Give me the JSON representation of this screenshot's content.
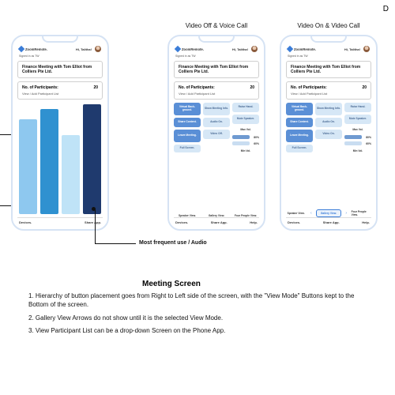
{
  "top_right_letter": "D",
  "columns": {
    "video_off": "Video Off & Voice Call",
    "video_on": "Video On & Video Call"
  },
  "phone_common": {
    "brand": "ZoomRemote.",
    "greeting": "Hi, Talitha!",
    "signed_in": "Signed in as TW",
    "meeting_title": "Finance Meeting with Tom Elliot from Colliers Pte Ltd.",
    "participants_label": "No. of Participants:",
    "participants_count": "20",
    "view_link": "View / Add Participant List",
    "bottom": {
      "devices": "Devices.",
      "share": "Share App.",
      "help": "Help."
    }
  },
  "buttons": {
    "virtual_bg": "Virtual Back-ground.",
    "share_content": "Share Content.",
    "leave": "Leave Meeting.",
    "full": "Full Screen.",
    "show_info": "Show Meeting Info.",
    "audio_on": "Audio On.",
    "video_off": "Video Off.",
    "video_on": "Video On.",
    "raise": "Raise Hand.",
    "mute": "Mute Speaker.",
    "max": "Max Vol.",
    "min": "Min Vol.",
    "pct80": "80%",
    "pct60": "60%",
    "speaker": "Speaker View.",
    "gallery": "Gallery View.",
    "four": "Four People View."
  },
  "callout": "Most frequent use / Audio",
  "section_title": "Meeting Screen",
  "notes": {
    "n1": "1. Hierarchy of button placement goes from Right to Left side of the screen, with the \"View Mode\" Buttons kept to the Bottom of the screen.",
    "n2": "2. Gallery View Arrows do not show until it is the selected View Mode.",
    "n3": "3. View Participant List can be a drop-down Screen on the Phone App."
  }
}
